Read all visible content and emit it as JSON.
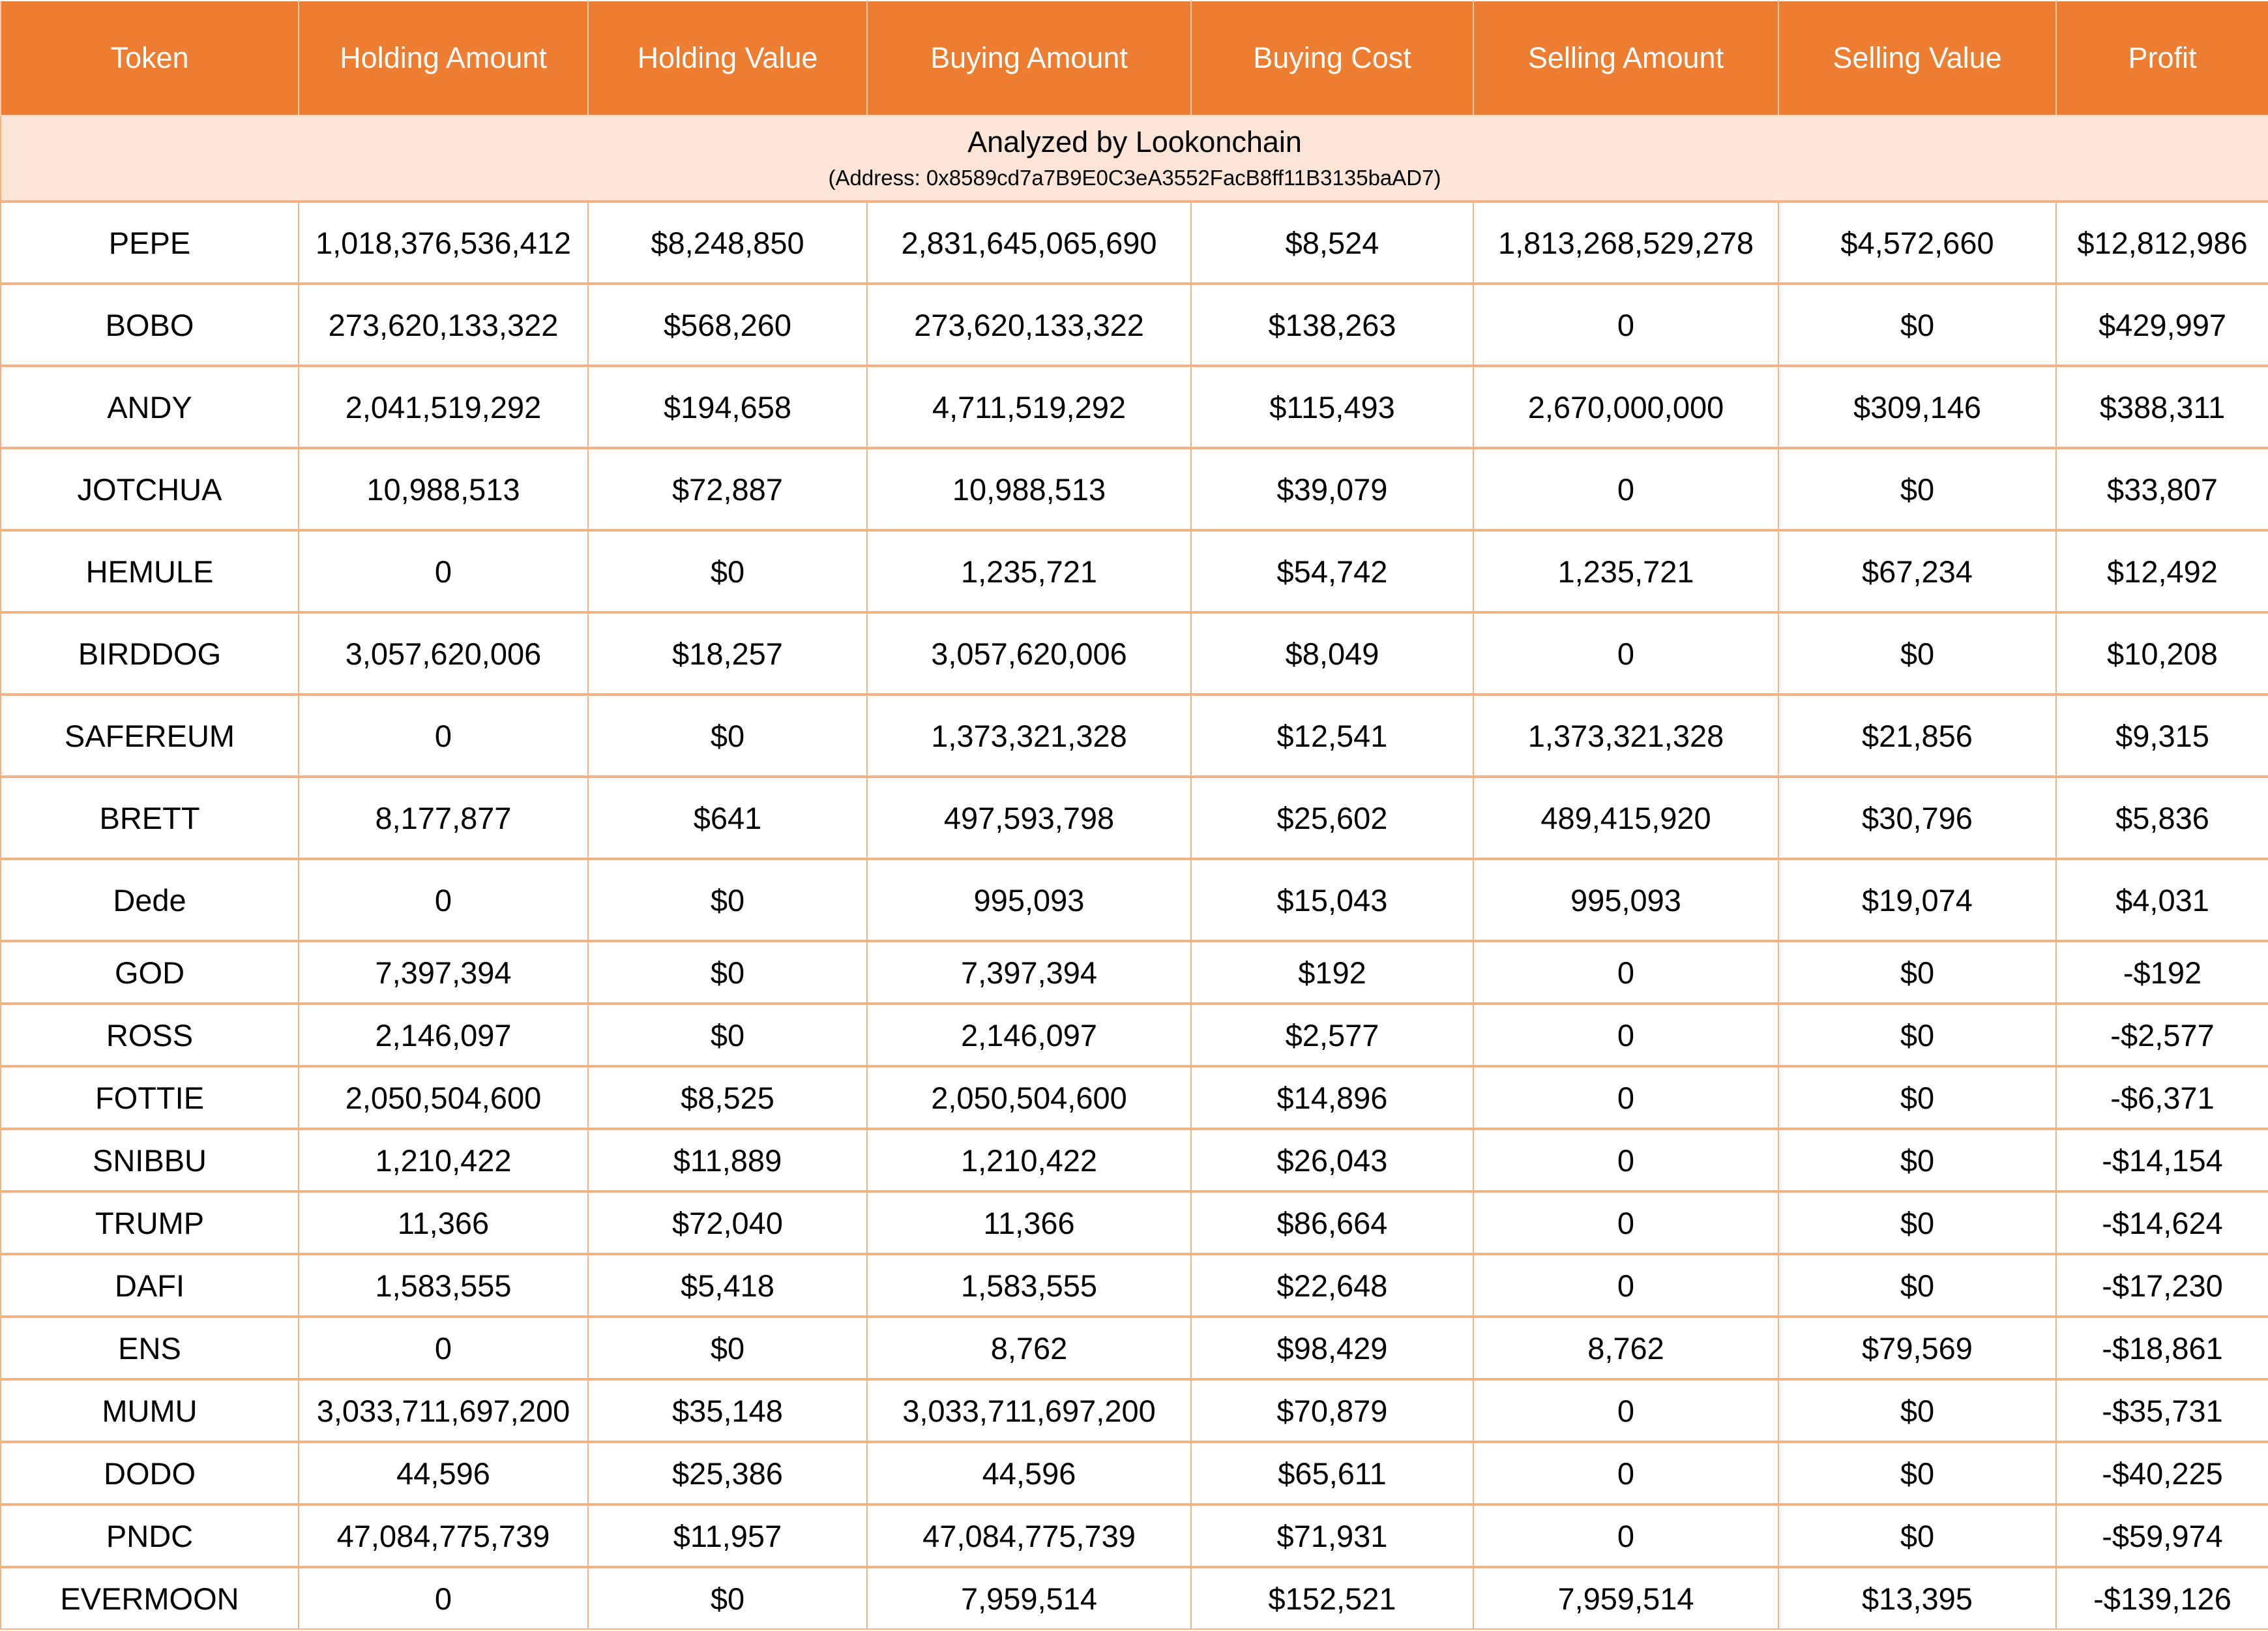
{
  "colors": {
    "header_bg": "#ED7D31",
    "header_text": "#FFFFFF",
    "banner_bg": "#FCE4D6",
    "grid": "#F4B183",
    "negative": "#FF0000"
  },
  "columns": [
    "Token",
    "Holding Amount",
    "Holding Value",
    "Buying Amount",
    "Buying Cost",
    "Selling Amount",
    "Selling Value",
    "Profit"
  ],
  "banner": {
    "title": "Analyzed by Lookonchain",
    "address": "(Address: 0x8589cd7a7B9E0C3eA3552FacB8ff11B3135baAD7)"
  },
  "rows": [
    {
      "token": "PEPE",
      "holding_amount": "1,018,376,536,412",
      "holding_value": "$8,248,850",
      "buying_amount": "2,831,645,065,690",
      "buying_cost": "$8,524",
      "selling_amount": "1,813,268,529,278",
      "selling_value": "$4,572,660",
      "profit": "$12,812,986",
      "negative": false
    },
    {
      "token": "BOBO",
      "holding_amount": "273,620,133,322",
      "holding_value": "$568,260",
      "buying_amount": "273,620,133,322",
      "buying_cost": "$138,263",
      "selling_amount": "0",
      "selling_value": "$0",
      "profit": "$429,997",
      "negative": false
    },
    {
      "token": "ANDY",
      "holding_amount": "2,041,519,292",
      "holding_value": "$194,658",
      "buying_amount": "4,711,519,292",
      "buying_cost": "$115,493",
      "selling_amount": "2,670,000,000",
      "selling_value": "$309,146",
      "profit": "$388,311",
      "negative": false
    },
    {
      "token": "JOTCHUA",
      "holding_amount": "10,988,513",
      "holding_value": "$72,887",
      "buying_amount": "10,988,513",
      "buying_cost": "$39,079",
      "selling_amount": "0",
      "selling_value": "$0",
      "profit": "$33,807",
      "negative": false
    },
    {
      "token": "HEMULE",
      "holding_amount": "0",
      "holding_value": "$0",
      "buying_amount": "1,235,721",
      "buying_cost": "$54,742",
      "selling_amount": "1,235,721",
      "selling_value": "$67,234",
      "profit": "$12,492",
      "negative": false
    },
    {
      "token": "BIRDDOG",
      "holding_amount": "3,057,620,006",
      "holding_value": "$18,257",
      "buying_amount": "3,057,620,006",
      "buying_cost": "$8,049",
      "selling_amount": "0",
      "selling_value": "$0",
      "profit": "$10,208",
      "negative": false
    },
    {
      "token": "SAFEREUM",
      "holding_amount": "0",
      "holding_value": "$0",
      "buying_amount": "1,373,321,328",
      "buying_cost": "$12,541",
      "selling_amount": "1,373,321,328",
      "selling_value": "$21,856",
      "profit": "$9,315",
      "negative": false
    },
    {
      "token": "BRETT",
      "holding_amount": "8,177,877",
      "holding_value": "$641",
      "buying_amount": "497,593,798",
      "buying_cost": "$25,602",
      "selling_amount": "489,415,920",
      "selling_value": "$30,796",
      "profit": "$5,836",
      "negative": false
    },
    {
      "token": "Dede",
      "holding_amount": "0",
      "holding_value": "$0",
      "buying_amount": "995,093",
      "buying_cost": "$15,043",
      "selling_amount": "995,093",
      "selling_value": "$19,074",
      "profit": "$4,031",
      "negative": false
    },
    {
      "token": "GOD",
      "holding_amount": "7,397,394",
      "holding_value": "$0",
      "buying_amount": "7,397,394",
      "buying_cost": "$192",
      "selling_amount": "0",
      "selling_value": "$0",
      "profit": "-$192",
      "negative": true
    },
    {
      "token": "ROSS",
      "holding_amount": "2,146,097",
      "holding_value": "$0",
      "buying_amount": "2,146,097",
      "buying_cost": "$2,577",
      "selling_amount": "0",
      "selling_value": "$0",
      "profit": "-$2,577",
      "negative": true
    },
    {
      "token": "FOTTIE",
      "holding_amount": "2,050,504,600",
      "holding_value": "$8,525",
      "buying_amount": "2,050,504,600",
      "buying_cost": "$14,896",
      "selling_amount": "0",
      "selling_value": "$0",
      "profit": "-$6,371",
      "negative": true
    },
    {
      "token": "SNIBBU",
      "holding_amount": "1,210,422",
      "holding_value": "$11,889",
      "buying_amount": "1,210,422",
      "buying_cost": "$26,043",
      "selling_amount": "0",
      "selling_value": "$0",
      "profit": "-$14,154",
      "negative": true
    },
    {
      "token": "TRUMP",
      "holding_amount": "11,366",
      "holding_value": "$72,040",
      "buying_amount": "11,366",
      "buying_cost": "$86,664",
      "selling_amount": "0",
      "selling_value": "$0",
      "profit": "-$14,624",
      "negative": true
    },
    {
      "token": "DAFI",
      "holding_amount": "1,583,555",
      "holding_value": "$5,418",
      "buying_amount": "1,583,555",
      "buying_cost": "$22,648",
      "selling_amount": "0",
      "selling_value": "$0",
      "profit": "-$17,230",
      "negative": true
    },
    {
      "token": "ENS",
      "holding_amount": "0",
      "holding_value": "$0",
      "buying_amount": "8,762",
      "buying_cost": "$98,429",
      "selling_amount": "8,762",
      "selling_value": "$79,569",
      "profit": "-$18,861",
      "negative": true
    },
    {
      "token": "MUMU",
      "holding_amount": "3,033,711,697,200",
      "holding_value": "$35,148",
      "buying_amount": "3,033,711,697,200",
      "buying_cost": "$70,879",
      "selling_amount": "0",
      "selling_value": "$0",
      "profit": "-$35,731",
      "negative": true
    },
    {
      "token": "DODO",
      "holding_amount": "44,596",
      "holding_value": "$25,386",
      "buying_amount": "44,596",
      "buying_cost": "$65,611",
      "selling_amount": "0",
      "selling_value": "$0",
      "profit": "-$40,225",
      "negative": true
    },
    {
      "token": "PNDC",
      "holding_amount": "47,084,775,739",
      "holding_value": "$11,957",
      "buying_amount": "47,084,775,739",
      "buying_cost": "$71,931",
      "selling_amount": "0",
      "selling_value": "$0",
      "profit": "-$59,974",
      "negative": true
    },
    {
      "token": "EVERMOON",
      "holding_amount": "0",
      "holding_value": "$0",
      "buying_amount": "7,959,514",
      "buying_cost": "$152,521",
      "selling_amount": "7,959,514",
      "selling_value": "$13,395",
      "profit": "-$139,126",
      "negative": true
    }
  ]
}
